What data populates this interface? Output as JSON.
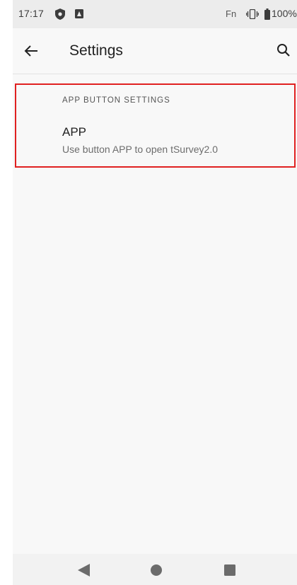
{
  "status_bar": {
    "time": "17:17",
    "fn_label": "Fn",
    "battery_text": "100%",
    "icons": [
      "shield-icon",
      "notification-icon",
      "vibrate-icon",
      "battery-icon"
    ]
  },
  "app_bar": {
    "title": "Settings",
    "back_icon": "arrow-back-icon",
    "search_icon": "search-icon"
  },
  "section": {
    "header": "APP BUTTON SETTINGS",
    "item": {
      "title": "APP",
      "summary": "Use button APP to open tSurvey2.0"
    }
  },
  "nav_bar": {
    "icons": [
      "nav-back-icon",
      "nav-home-icon",
      "nav-recents-icon"
    ]
  },
  "colors": {
    "highlight_border": "#e02020",
    "status_bar_bg": "#ececec",
    "background": "#f8f8f8"
  }
}
